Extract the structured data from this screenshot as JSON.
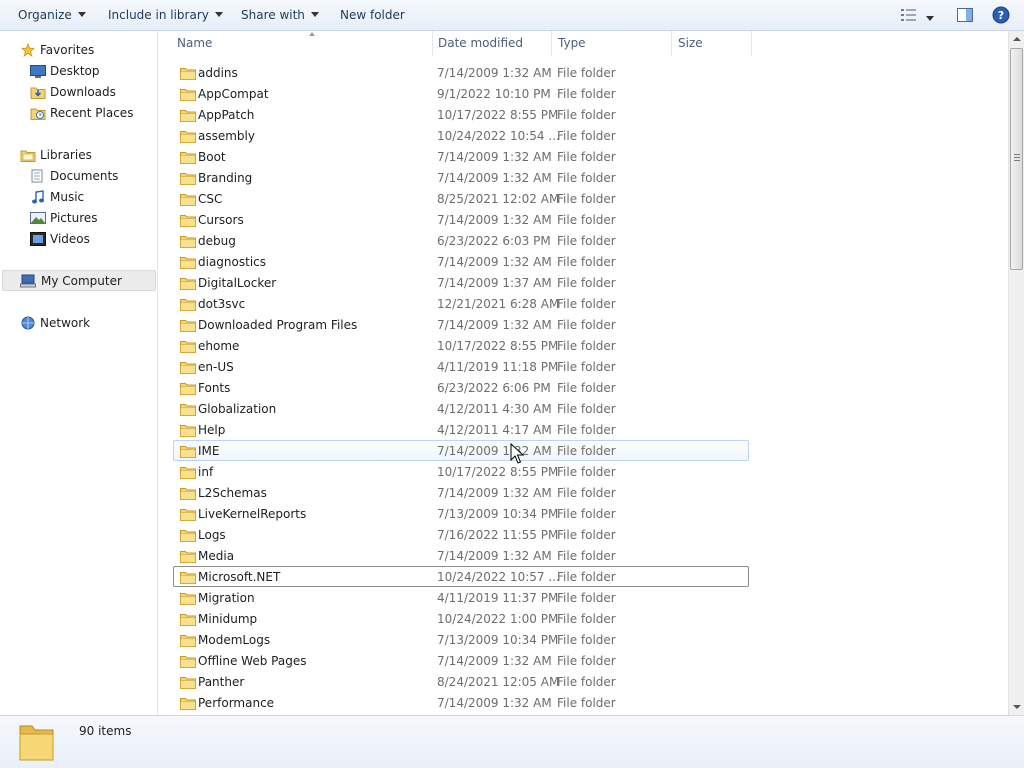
{
  "toolbar": {
    "organize": "Organize",
    "include_in_library": "Include in library",
    "share_with": "Share with",
    "new_folder": "New folder"
  },
  "nav": {
    "favorites": "Favorites",
    "desktop": "Desktop",
    "downloads": "Downloads",
    "recent_places": "Recent Places",
    "libraries": "Libraries",
    "documents": "Documents",
    "music": "Music",
    "pictures": "Pictures",
    "videos": "Videos",
    "my_computer": "My Computer",
    "network": "Network"
  },
  "columns": {
    "name": "Name",
    "date_modified": "Date modified",
    "type": "Type",
    "size": "Size"
  },
  "rows": [
    {
      "name": "addins",
      "date": "7/14/2009 1:32 AM",
      "type": "File folder"
    },
    {
      "name": "AppCompat",
      "date": "9/1/2022 10:10 PM",
      "type": "File folder"
    },
    {
      "name": "AppPatch",
      "date": "10/17/2022 8:55 PM",
      "type": "File folder"
    },
    {
      "name": "assembly",
      "date": "10/24/2022 10:54 ...",
      "type": "File folder"
    },
    {
      "name": "Boot",
      "date": "7/14/2009 1:32 AM",
      "type": "File folder"
    },
    {
      "name": "Branding",
      "date": "7/14/2009 1:32 AM",
      "type": "File folder"
    },
    {
      "name": "CSC",
      "date": "8/25/2021 12:02 AM",
      "type": "File folder"
    },
    {
      "name": "Cursors",
      "date": "7/14/2009 1:32 AM",
      "type": "File folder"
    },
    {
      "name": "debug",
      "date": "6/23/2022 6:03 PM",
      "type": "File folder"
    },
    {
      "name": "diagnostics",
      "date": "7/14/2009 1:32 AM",
      "type": "File folder"
    },
    {
      "name": "DigitalLocker",
      "date": "7/14/2009 1:37 AM",
      "type": "File folder"
    },
    {
      "name": "dot3svc",
      "date": "12/21/2021 6:28 AM",
      "type": "File folder"
    },
    {
      "name": "Downloaded Program Files",
      "date": "7/14/2009 1:32 AM",
      "type": "File folder"
    },
    {
      "name": "ehome",
      "date": "10/17/2022 8:55 PM",
      "type": "File folder"
    },
    {
      "name": "en-US",
      "date": "4/11/2019 11:18 PM",
      "type": "File folder"
    },
    {
      "name": "Fonts",
      "date": "6/23/2022 6:06 PM",
      "type": "File folder"
    },
    {
      "name": "Globalization",
      "date": "4/12/2011 4:30 AM",
      "type": "File folder"
    },
    {
      "name": "Help",
      "date": "4/12/2011 4:17 AM",
      "type": "File folder"
    },
    {
      "name": "IME",
      "date": "7/14/2009 1:32 AM",
      "type": "File folder"
    },
    {
      "name": "inf",
      "date": "10/17/2022 8:55 PM",
      "type": "File folder"
    },
    {
      "name": "L2Schemas",
      "date": "7/14/2009 1:32 AM",
      "type": "File folder"
    },
    {
      "name": "LiveKernelReports",
      "date": "7/13/2009 10:34 PM",
      "type": "File folder"
    },
    {
      "name": "Logs",
      "date": "7/16/2022 11:55 PM",
      "type": "File folder"
    },
    {
      "name": "Media",
      "date": "7/14/2009 1:32 AM",
      "type": "File folder"
    },
    {
      "name": "Microsoft.NET",
      "date": "10/24/2022 10:57 ...",
      "type": "File folder"
    },
    {
      "name": "Migration",
      "date": "4/11/2019 11:37 PM",
      "type": "File folder"
    },
    {
      "name": "Minidump",
      "date": "10/24/2022 1:00 PM",
      "type": "File folder"
    },
    {
      "name": "ModemLogs",
      "date": "7/13/2009 10:34 PM",
      "type": "File folder"
    },
    {
      "name": "Offline Web Pages",
      "date": "7/14/2009 1:32 AM",
      "type": "File folder"
    },
    {
      "name": "Panther",
      "date": "8/24/2021 12:05 AM",
      "type": "File folder"
    },
    {
      "name": "Performance",
      "date": "7/14/2009 1:32 AM",
      "type": "File folder"
    }
  ],
  "status": {
    "item_count": "90 items"
  }
}
